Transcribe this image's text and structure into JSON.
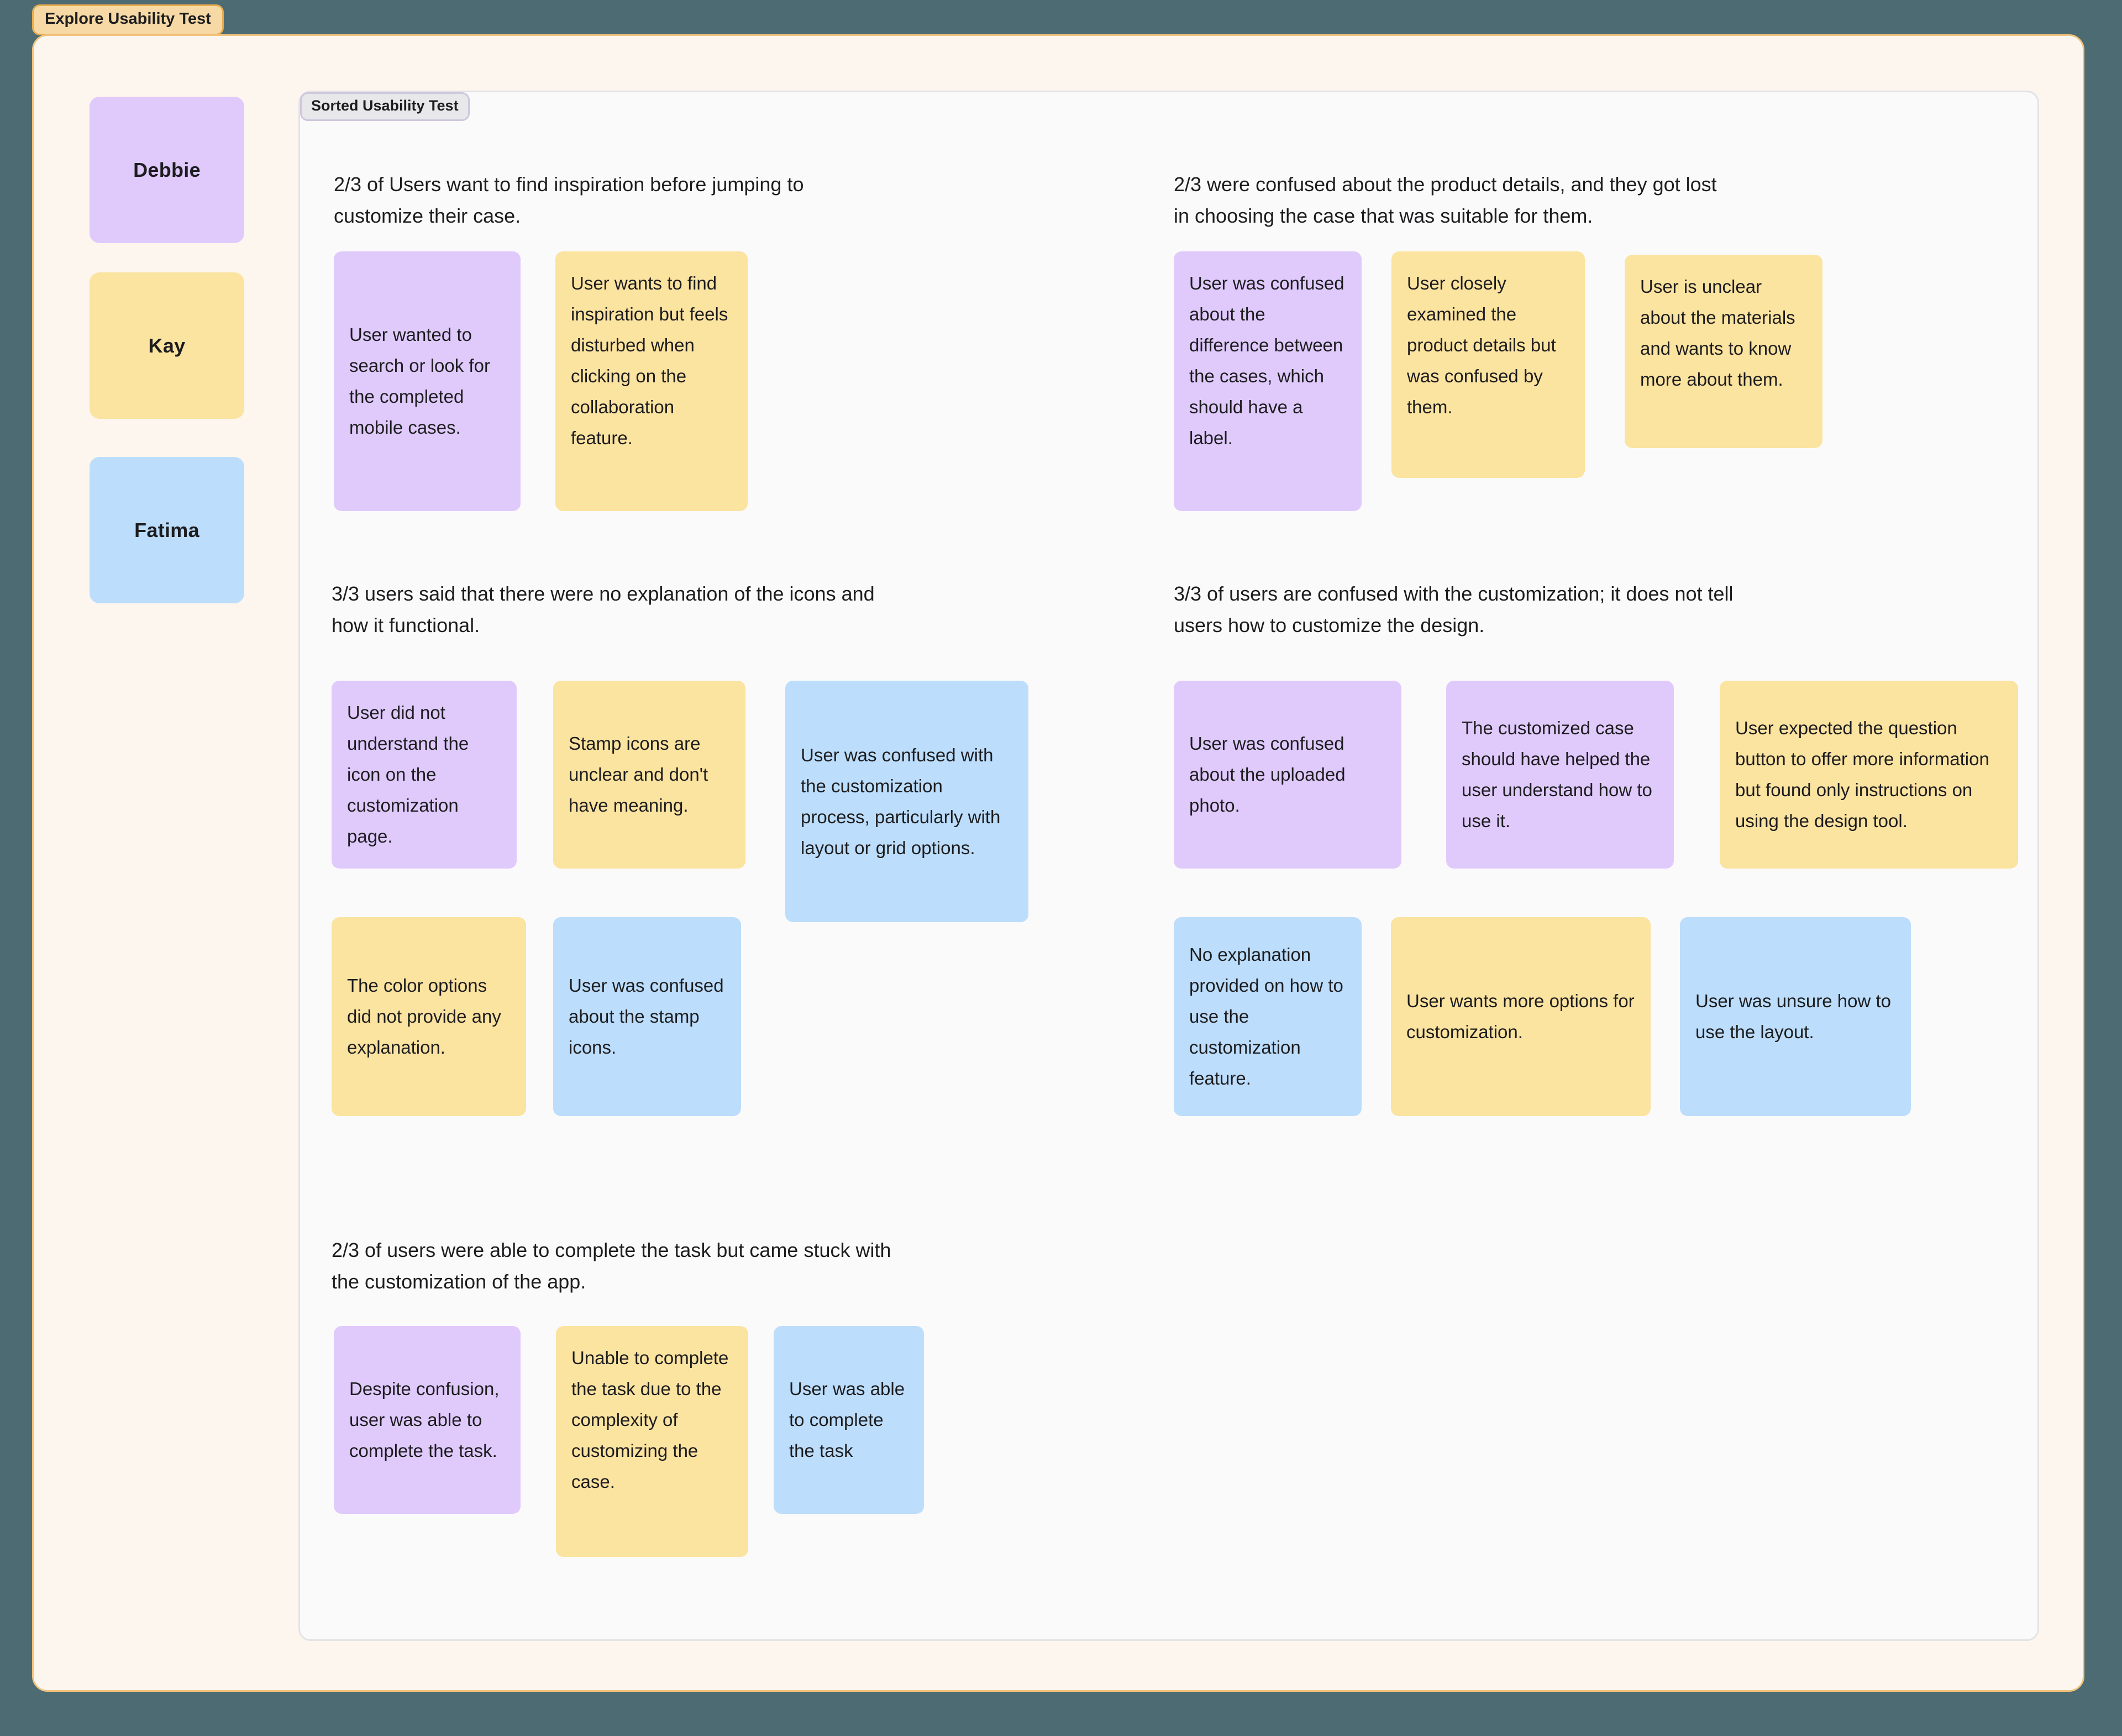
{
  "board": {
    "tab_label": "Explore Usability Test",
    "frame_color": "#fdf6ef",
    "canvas_color": "#4c6b72"
  },
  "panel": {
    "tab_label": "Sorted Usability Test",
    "background": "#fafafa"
  },
  "participants": [
    {
      "name": "Debbie",
      "color": "#e0cafc"
    },
    {
      "name": "Kay",
      "color": "#fbe3a0"
    },
    {
      "name": "Fatima",
      "color": "#bcddfb"
    }
  ],
  "colors": {
    "purple": "#e0cafc",
    "yellow": "#fbe3a0",
    "blue": "#bcddfb"
  },
  "sections": [
    {
      "heading": "2/3 of Users want to find inspiration before jumping to\ncustomize their case.",
      "notes": [
        {
          "text": "User wanted to search or look for the completed mobile cases.",
          "color": "purple"
        },
        {
          "text": "User wants to find inspiration but feels disturbed when clicking on the collaboration feature.",
          "color": "yellow"
        }
      ]
    },
    {
      "heading": "2/3 were confused about the product details, and they got lost\nin choosing the case that was suitable for them.",
      "notes": [
        {
          "text": "User was confused about the difference between the cases, which should have a label.",
          "color": "purple"
        },
        {
          "text": "User closely examined the product details but was confused by them.",
          "color": "yellow"
        },
        {
          "text": "User is unclear about the materials and wants to know more about them.",
          "color": "yellow"
        }
      ]
    },
    {
      "heading": "3/3 users said that there were no explanation of the icons and\nhow it functional.",
      "notes": [
        {
          "text": "User did not understand the icon on the customization page.",
          "color": "purple"
        },
        {
          "text": "Stamp icons are unclear and don't have meaning.",
          "color": "yellow"
        },
        {
          "text": "User was confused with the customization process, particularly with layout or grid options.",
          "color": "blue"
        },
        {
          "text": "The color options did not provide any explanation.",
          "color": "yellow"
        },
        {
          "text": "User was confused about the stamp icons.",
          "color": "blue"
        }
      ]
    },
    {
      "heading": "3/3 of users are confused with the customization; it does not tell\nusers how to customize the design.",
      "notes": [
        {
          "text": "User was confused about the uploaded photo.",
          "color": "purple"
        },
        {
          "text": "The customized case should have helped the user understand how to use it.",
          "color": "purple"
        },
        {
          "text": "User expected the question button to offer more information but found only instructions on using the design tool.",
          "color": "yellow"
        },
        {
          "text": "No explanation provided on how to use the customization feature.",
          "color": "blue"
        },
        {
          "text": "User wants more options for customization.",
          "color": "yellow"
        },
        {
          "text": "User was unsure how to use the layout.",
          "color": "blue"
        }
      ]
    },
    {
      "heading": "2/3 of users were able to complete the task but came stuck with\nthe customization of the app.",
      "notes": [
        {
          "text": "Despite confusion, user was able to complete the task.",
          "color": "purple"
        },
        {
          "text": "Unable to complete the task due to the complexity of customizing the case.",
          "color": "yellow"
        },
        {
          "text": "User was able to complete the task",
          "color": "blue"
        }
      ]
    }
  ]
}
